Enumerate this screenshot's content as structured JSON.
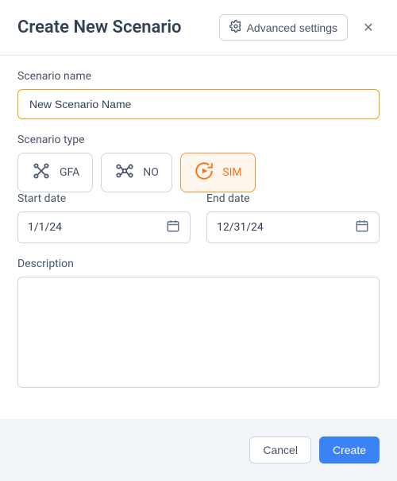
{
  "header": {
    "title": "Create New Scenario",
    "advanced_label": "Advanced settings"
  },
  "fields": {
    "name_label": "Scenario name",
    "name_value": "New Scenario Name",
    "type_label": "Scenario type",
    "types": [
      {
        "code": "GFA",
        "selected": false
      },
      {
        "code": "NO",
        "selected": false
      },
      {
        "code": "SIM",
        "selected": true
      }
    ],
    "start_label": "Start date",
    "start_value": "1/1/24",
    "end_label": "End date",
    "end_value": "12/31/24",
    "desc_label": "Description",
    "desc_value": ""
  },
  "footer": {
    "cancel": "Cancel",
    "create": "Create"
  }
}
